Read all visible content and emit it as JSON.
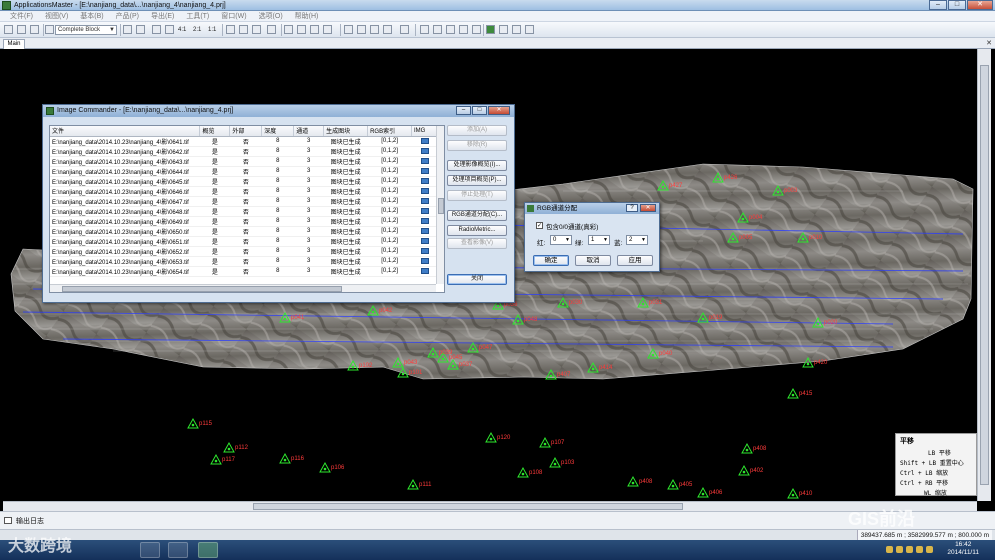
{
  "app": {
    "title": "ApplicationsMaster - [E:\\nanjiang_data\\...\\nanjiang_4\\nanjiang_4.prj]",
    "menu": [
      "文件(F)",
      "视图(V)",
      "基本(B)",
      "产品(P)",
      "导出(E)",
      "工具(T)",
      "窗口(W)",
      "选项(O)",
      "帮助(H)"
    ],
    "toolbar": {
      "block_select": "Complete Block",
      "labels": [
        "4:1",
        "2:1",
        "1:1"
      ]
    },
    "tab_main": "Main",
    "output_tab": "输出日志",
    "status_coords": "389437.685 m ; 3582999.577 m ; 800.000 m"
  },
  "image_commander": {
    "title": "Image Commander - [E:\\nanjiang_data\\...\\nanjiang_4.prj]",
    "columns": [
      "文件",
      "概览",
      "外部",
      "深度",
      "通道",
      "生成图块",
      "RGB索引",
      "IMG"
    ],
    "rows": [
      [
        "E:\\nanjiang_data\\2014.10.23\\nanjiang_4\\影\\0641.tif",
        "是",
        "否",
        "8",
        "3",
        "图块已生成",
        "[0,1,2]"
      ],
      [
        "E:\\nanjiang_data\\2014.10.23\\nanjiang_4\\影\\0642.tif",
        "是",
        "否",
        "8",
        "3",
        "图块已生成",
        "[0,1,2]"
      ],
      [
        "E:\\nanjiang_data\\2014.10.23\\nanjiang_4\\影\\0643.tif",
        "是",
        "否",
        "8",
        "3",
        "图块已生成",
        "[0,1,2]"
      ],
      [
        "E:\\nanjiang_data\\2014.10.23\\nanjiang_4\\影\\0644.tif",
        "是",
        "否",
        "8",
        "3",
        "图块已生成",
        "[0,1,2]"
      ],
      [
        "E:\\nanjiang_data\\2014.10.23\\nanjiang_4\\影\\0645.tif",
        "是",
        "否",
        "8",
        "3",
        "图块已生成",
        "[0,1,2]"
      ],
      [
        "E:\\nanjiang_data\\2014.10.23\\nanjiang_4\\影\\0646.tif",
        "是",
        "否",
        "8",
        "3",
        "图块已生成",
        "[0,1,2]"
      ],
      [
        "E:\\nanjiang_data\\2014.10.23\\nanjiang_4\\影\\0647.tif",
        "是",
        "否",
        "8",
        "3",
        "图块已生成",
        "[0,1,2]"
      ],
      [
        "E:\\nanjiang_data\\2014.10.23\\nanjiang_4\\影\\0648.tif",
        "是",
        "否",
        "8",
        "3",
        "图块已生成",
        "[0,1,2]"
      ],
      [
        "E:\\nanjiang_data\\2014.10.23\\nanjiang_4\\影\\0649.tif",
        "是",
        "否",
        "8",
        "3",
        "图块已生成",
        "[0,1,2]"
      ],
      [
        "E:\\nanjiang_data\\2014.10.23\\nanjiang_4\\影\\0650.tif",
        "是",
        "否",
        "8",
        "3",
        "图块已生成",
        "[0,1,2]"
      ],
      [
        "E:\\nanjiang_data\\2014.10.23\\nanjiang_4\\影\\0651.tif",
        "是",
        "否",
        "8",
        "3",
        "图块已生成",
        "[0,1,2]"
      ],
      [
        "E:\\nanjiang_data\\2014.10.23\\nanjiang_4\\影\\0652.tif",
        "是",
        "否",
        "8",
        "3",
        "图块已生成",
        "[0,1,2]"
      ],
      [
        "E:\\nanjiang_data\\2014.10.23\\nanjiang_4\\影\\0653.tif",
        "是",
        "否",
        "8",
        "3",
        "图块已生成",
        "[0,1,2]"
      ],
      [
        "E:\\nanjiang_data\\2014.10.23\\nanjiang_4\\影\\0654.tif",
        "是",
        "否",
        "8",
        "3",
        "图块已生成",
        "[0,1,2]"
      ]
    ],
    "buttons": {
      "add": "添加(A)",
      "remove": "移除(R)",
      "process_overview": "处理影像概览(I)...",
      "process_tiles": "处理项目概览(P)...",
      "stop": "停止处理(T)",
      "rgb_assign": "RGB通道分配(C)...",
      "radiometric": "RadioMetric...",
      "view_image": "查看影像(V)",
      "close": "关闭"
    }
  },
  "rgb_dialog": {
    "title": "RGB通道分配",
    "checkbox_label": "包含0/0通道(真彩)",
    "checked": true,
    "red_label": "红:",
    "red_value": "0",
    "green_label": "绿:",
    "green_value": "1",
    "blue_label": "蓝:",
    "blue_value": "2",
    "ok": "确定",
    "cancel": "取消",
    "apply": "应用"
  },
  "pan_panel": {
    "title": "平移",
    "rows": [
      {
        "key": "LB",
        "action": "平移"
      },
      {
        "key": "Shift + LB",
        "action": "重置中心"
      },
      {
        "key": "Ctrl + LB",
        "action": "缩放"
      },
      {
        "key": "Ctrl + RB",
        "action": "平移"
      },
      {
        "key": "WL",
        "action": "缩放"
      }
    ]
  },
  "gcp_labels": [
    "p115",
    "p112",
    "p117",
    "p120",
    "p107",
    "p103",
    "p108",
    "p111",
    "p116",
    "p106",
    "p102",
    "p101",
    "p415",
    "p408",
    "p410",
    "p402",
    "p406",
    "p405",
    "p408",
    "p407",
    "p414",
    "p420",
    "p427",
    "p426",
    "p004",
    "p005",
    "p003",
    "p010",
    "p020",
    "p019",
    "p031",
    "p030",
    "p036",
    "p037",
    "p039",
    "p040",
    "p041",
    "p042",
    "p043",
    "p045",
    "p047",
    "p048"
  ],
  "taskbar": {
    "time": "16:42",
    "date": "2014/11/11"
  },
  "watermarks": {
    "left": "大数跨境",
    "right": "GIS前沿"
  },
  "colors": {
    "gcp": "#2ee82e",
    "gcp_label": "#ff3b3b",
    "flight_line": "#2a3cff"
  }
}
